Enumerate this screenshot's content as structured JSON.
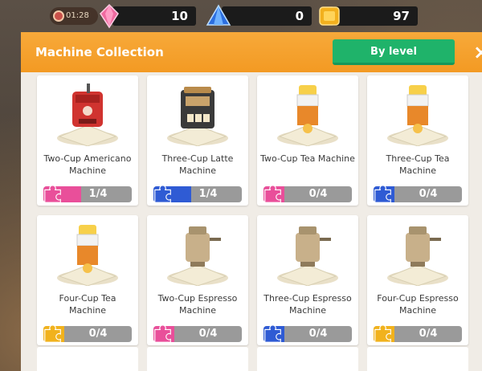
{
  "hud": {
    "timer": "01:28",
    "gems": "10",
    "crystals": "0",
    "gold": "97"
  },
  "panel": {
    "title": "Machine Collection",
    "sort_label": "By level",
    "close_label": "×"
  },
  "machines": [
    {
      "name": "Two-Cup Americano Machine",
      "count": "1/4",
      "progress": 0.25,
      "puzzle_color": "#e94f9a",
      "style": "americano"
    },
    {
      "name": "Three-Cup Latte Machine",
      "count": "1/4",
      "progress": 0.25,
      "puzzle_color": "#2f5bd4",
      "style": "latte"
    },
    {
      "name": "Two-Cup Tea Machine",
      "count": "0/4",
      "progress": 0,
      "puzzle_color": "#e94f9a",
      "style": "tea"
    },
    {
      "name": "Three-Cup Tea Machine",
      "count": "0/4",
      "progress": 0,
      "puzzle_color": "#2f5bd4",
      "style": "tea"
    },
    {
      "name": "Four-Cup Tea Machine",
      "count": "0/4",
      "progress": 0,
      "puzzle_color": "#f1b21d",
      "style": "tea"
    },
    {
      "name": "Two-Cup Espresso Machine",
      "count": "0/4",
      "progress": 0,
      "puzzle_color": "#e94f9a",
      "style": "espresso"
    },
    {
      "name": "Three-Cup Espresso Machine",
      "count": "0/4",
      "progress": 0,
      "puzzle_color": "#2f5bd4",
      "style": "espresso"
    },
    {
      "name": "Four-Cup Espresso Machine",
      "count": "0/4",
      "progress": 0,
      "puzzle_color": "#f1b21d",
      "style": "espresso"
    }
  ]
}
